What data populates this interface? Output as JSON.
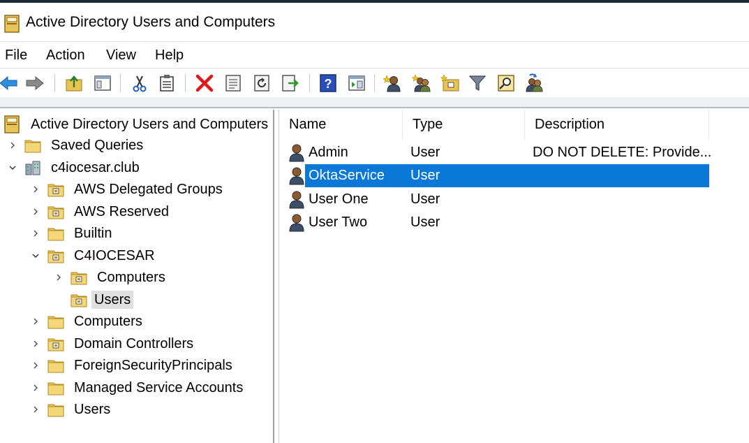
{
  "window": {
    "title": "Active Directory Users and Computers"
  },
  "menu": [
    "File",
    "Action",
    "View",
    "Help"
  ],
  "toolbar": {
    "icons": [
      "back-arrow-icon",
      "forward-arrow-icon",
      "up-folder-icon",
      "show-console-tree-icon",
      "cut-icon",
      "clipboard-icon",
      "delete-icon",
      "properties-icon",
      "refresh-icon",
      "export-list-icon",
      "help-icon",
      "action-pane-icon",
      "new-user-icon",
      "new-group-icon",
      "new-ou-icon",
      "filter-icon",
      "find-icon",
      "add-to-group-icon"
    ]
  },
  "tree": {
    "root": "Active Directory Users and Computers",
    "items": [
      {
        "label": "Saved Queries"
      },
      {
        "label": "c4iocesar.club"
      },
      {
        "label": "AWS Delegated Groups"
      },
      {
        "label": "AWS Reserved"
      },
      {
        "label": "Builtin"
      },
      {
        "label": "C4IOCESAR"
      },
      {
        "label": "Computers"
      },
      {
        "label": "Users"
      },
      {
        "label": "Computers"
      },
      {
        "label": "Domain Controllers"
      },
      {
        "label": "ForeignSecurityPrincipals"
      },
      {
        "label": "Managed Service Accounts"
      },
      {
        "label": "Users"
      }
    ]
  },
  "list": {
    "columns": [
      "Name",
      "Type",
      "Description"
    ],
    "rows": [
      {
        "name": "Admin",
        "type": "User",
        "description": "DO NOT DELETE:  Provide..."
      },
      {
        "name": "OktaService",
        "type": "User",
        "description": ""
      },
      {
        "name": "User One",
        "type": "User",
        "description": ""
      },
      {
        "name": "User Two",
        "type": "User",
        "description": ""
      }
    ],
    "selected_row": "OktaService"
  },
  "colors": {
    "selection": "#0a78d7",
    "folder": "#e8c454",
    "title_bar_accent": "#1c2b3a"
  }
}
